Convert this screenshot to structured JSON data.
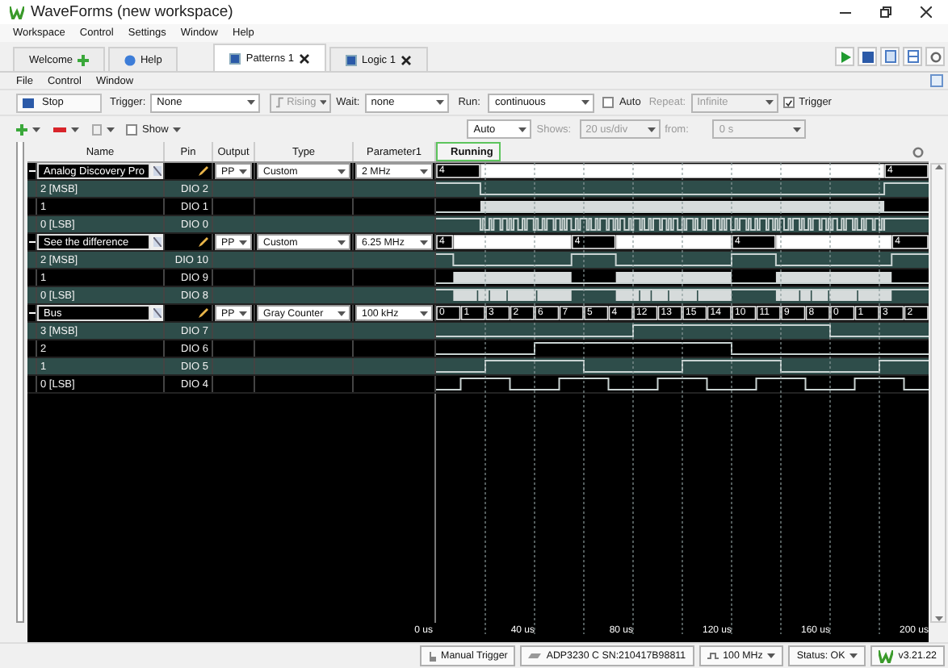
{
  "window": {
    "title": "WaveForms (new workspace)"
  },
  "menu": [
    "Workspace",
    "Control",
    "Settings",
    "Window",
    "Help"
  ],
  "tabs": [
    {
      "kind": "welcome",
      "label": "Welcome",
      "selected": false,
      "closable": false
    },
    {
      "kind": "help",
      "label": "Help",
      "selected": false,
      "closable": false
    },
    {
      "kind": "instrument",
      "label": "Patterns 1",
      "selected": true,
      "closable": true
    },
    {
      "kind": "instrument",
      "label": "Logic 1",
      "selected": false,
      "closable": true
    }
  ],
  "submenu": [
    "File",
    "Control",
    "Window"
  ],
  "toolbar": {
    "stop": "Stop",
    "trigger_label": "Trigger:",
    "trigger": {
      "value": "None",
      "disabled": false
    },
    "edge": {
      "value": "Rising",
      "disabled": true
    },
    "wait_label": "Wait:",
    "wait": {
      "value": "none",
      "disabled": false
    },
    "run_label": "Run:",
    "run": {
      "value": "continuous",
      "disabled": false
    },
    "auto": {
      "label": "Auto",
      "checked": false
    },
    "repeat_label": "Repeat:",
    "repeat": {
      "value": "Infinite",
      "disabled": true
    },
    "trigger_check": {
      "label": "Trigger",
      "checked": true
    }
  },
  "view_bar": {
    "show": {
      "label": "Show",
      "checked": false
    },
    "mode": {
      "value": "Auto",
      "disabled": false
    },
    "shows_label": "Shows:",
    "shows": {
      "value": "20 us/div",
      "disabled": true
    },
    "from_label": "from:",
    "from": {
      "value": "0 s",
      "disabled": true
    }
  },
  "table": {
    "columns": [
      "Name",
      "Pin",
      "Output",
      "Type",
      "Parameter1"
    ],
    "status": "Running",
    "rows": [
      {
        "kind": "bus",
        "expanded": true,
        "name": "Analog Discovery Pro",
        "output": "PP",
        "type": "Custom",
        "parameter": "2 MHz",
        "values": [
          "4",
          "4"
        ]
      },
      {
        "kind": "bit",
        "name": "2 [MSB]",
        "pin": "DIO 2"
      },
      {
        "kind": "bit",
        "name": "1",
        "pin": "DIO 1"
      },
      {
        "kind": "bit",
        "name": "0 [LSB]",
        "pin": "DIO 0"
      },
      {
        "kind": "bus",
        "expanded": true,
        "name": "See the difference",
        "output": "PP",
        "type": "Custom",
        "parameter": "6.25 MHz",
        "values": [
          "4",
          "4",
          "4",
          "4"
        ]
      },
      {
        "kind": "bit",
        "name": "2 [MSB]",
        "pin": "DIO 10"
      },
      {
        "kind": "bit",
        "name": "1",
        "pin": "DIO 9"
      },
      {
        "kind": "bit",
        "name": "0 [LSB]",
        "pin": "DIO 8"
      },
      {
        "kind": "bus",
        "expanded": true,
        "name": "Bus",
        "output": "PP",
        "type": "Gray Counter",
        "parameter": "100 kHz",
        "values": [
          "0",
          "1",
          "3",
          "2",
          "6",
          "7",
          "5",
          "4",
          "12",
          "13",
          "15",
          "14",
          "10",
          "11",
          "9",
          "8",
          "0",
          "1",
          "3",
          "2"
        ]
      },
      {
        "kind": "bit",
        "name": "3 [MSB]",
        "pin": "DIO 7"
      },
      {
        "kind": "bit",
        "name": "2",
        "pin": "DIO 6"
      },
      {
        "kind": "bit",
        "name": "1",
        "pin": "DIO 5"
      },
      {
        "kind": "bit",
        "name": "0 [LSB]",
        "pin": "DIO 4"
      }
    ]
  },
  "axis": [
    "0 us",
    "40 us",
    "80 us",
    "120 us",
    "160 us",
    "200 us"
  ],
  "status_bar": [
    {
      "kind": "trigger",
      "label": "Manual Trigger"
    },
    {
      "kind": "device",
      "label": "ADP3230 C SN:210417B98811"
    },
    {
      "kind": "clock",
      "label": "100 MHz"
    },
    {
      "kind": "status",
      "label": "Status: OK"
    },
    {
      "kind": "version",
      "label": "v3.21.22"
    }
  ]
}
